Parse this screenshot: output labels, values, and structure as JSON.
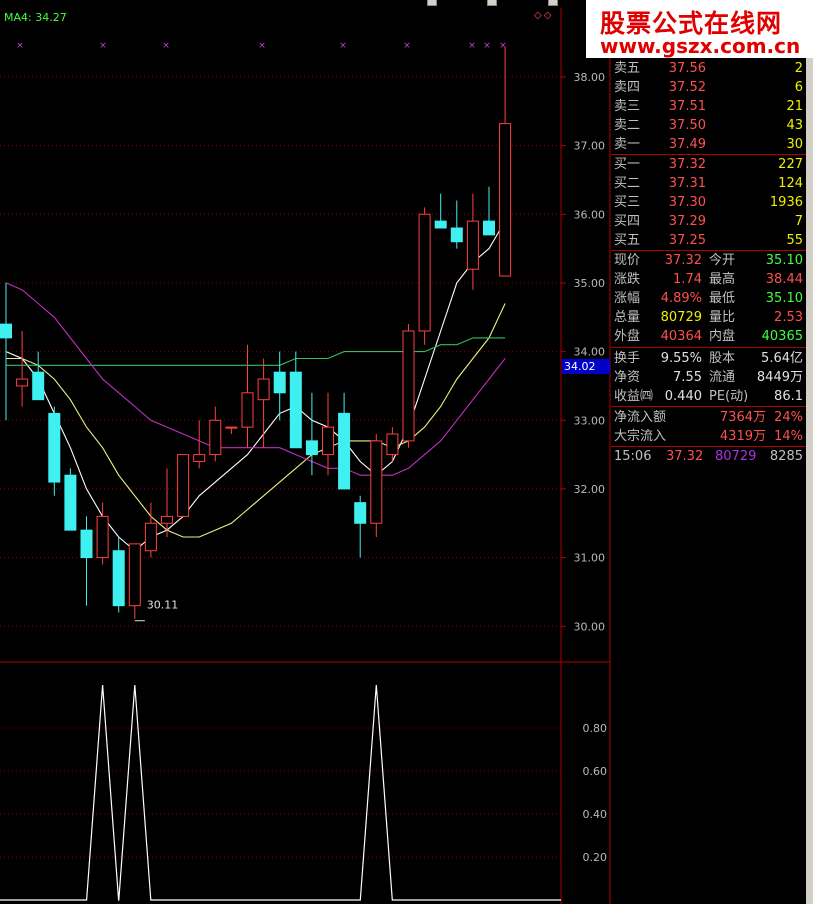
{
  "window": {
    "title": "",
    "buttons": [
      "",
      "",
      ""
    ]
  },
  "indicator": {
    "ma_label": "MA4: 34.27",
    "corner_mark": "◇◇"
  },
  "chart": {
    "price_axis": [
      "38.00",
      "37.00",
      "36.00",
      "35.00",
      "34.00",
      "33.00",
      "32.00",
      "31.00",
      "30.00"
    ],
    "current_price_tag": "34.02",
    "low_annotation": "30.11",
    "lower_axis": [
      "0.80",
      "0.60",
      "0.40",
      "0.20"
    ]
  },
  "chart_data": {
    "type": "candlestick",
    "ylim": [
      29.8,
      38.8
    ],
    "candles": [
      {
        "o": 34.2,
        "h": 35.0,
        "l": 33.0,
        "c": 34.4,
        "up": false
      },
      {
        "o": 33.6,
        "h": 34.3,
        "l": 33.2,
        "c": 33.5,
        "up": true
      },
      {
        "o": 33.7,
        "h": 34.0,
        "l": 33.3,
        "c": 33.3,
        "up": false
      },
      {
        "o": 33.1,
        "h": 33.2,
        "l": 31.9,
        "c": 32.1,
        "up": false
      },
      {
        "o": 32.2,
        "h": 32.3,
        "l": 31.4,
        "c": 31.4,
        "up": false
      },
      {
        "o": 31.4,
        "h": 31.6,
        "l": 30.3,
        "c": 31.0,
        "up": false
      },
      {
        "o": 31.0,
        "h": 31.8,
        "l": 30.9,
        "c": 31.6,
        "up": true
      },
      {
        "o": 31.1,
        "h": 31.3,
        "l": 30.2,
        "c": 30.3,
        "up": false
      },
      {
        "o": 30.3,
        "h": 31.2,
        "l": 30.11,
        "c": 31.2,
        "up": true
      },
      {
        "o": 31.1,
        "h": 31.8,
        "l": 31.0,
        "c": 31.5,
        "up": true
      },
      {
        "o": 31.5,
        "h": 32.3,
        "l": 31.3,
        "c": 31.6,
        "up": true
      },
      {
        "o": 31.6,
        "h": 32.5,
        "l": 31.6,
        "c": 32.5,
        "up": true
      },
      {
        "o": 32.4,
        "h": 33.0,
        "l": 32.3,
        "c": 32.5,
        "up": true
      },
      {
        "o": 32.5,
        "h": 33.2,
        "l": 32.4,
        "c": 33.0,
        "up": true
      },
      {
        "o": 32.9,
        "h": 32.9,
        "l": 32.8,
        "c": 32.9,
        "up": true
      },
      {
        "o": 32.9,
        "h": 34.1,
        "l": 32.6,
        "c": 33.4,
        "up": true
      },
      {
        "o": 33.3,
        "h": 33.9,
        "l": 32.6,
        "c": 33.6,
        "up": true
      },
      {
        "o": 33.7,
        "h": 34.0,
        "l": 33.0,
        "c": 33.4,
        "up": false
      },
      {
        "o": 33.7,
        "h": 34.0,
        "l": 32.6,
        "c": 32.6,
        "up": false
      },
      {
        "o": 32.7,
        "h": 33.4,
        "l": 32.2,
        "c": 32.5,
        "up": false
      },
      {
        "o": 32.5,
        "h": 33.4,
        "l": 32.2,
        "c": 32.9,
        "up": true
      },
      {
        "o": 33.1,
        "h": 33.4,
        "l": 32.0,
        "c": 32.0,
        "up": false
      },
      {
        "o": 31.8,
        "h": 31.9,
        "l": 31.0,
        "c": 31.5,
        "up": false
      },
      {
        "o": 31.5,
        "h": 32.8,
        "l": 31.3,
        "c": 32.7,
        "up": true
      },
      {
        "o": 32.5,
        "h": 32.9,
        "l": 32.4,
        "c": 32.8,
        "up": true
      },
      {
        "o": 32.7,
        "h": 34.4,
        "l": 32.6,
        "c": 34.3,
        "up": true
      },
      {
        "o": 34.3,
        "h": 36.1,
        "l": 34.1,
        "c": 36.0,
        "up": true
      },
      {
        "o": 35.9,
        "h": 36.3,
        "l": 35.8,
        "c": 35.8,
        "up": false
      },
      {
        "o": 35.8,
        "h": 36.2,
        "l": 35.5,
        "c": 35.6,
        "up": false
      },
      {
        "o": 35.2,
        "h": 36.3,
        "l": 34.9,
        "c": 35.9,
        "up": true
      },
      {
        "o": 35.9,
        "h": 36.4,
        "l": 35.7,
        "c": 35.7,
        "up": false
      },
      {
        "o": 35.1,
        "h": 38.44,
        "l": 35.1,
        "c": 37.32,
        "up": true
      }
    ],
    "ma_series": [
      {
        "name": "MA4",
        "color": "#ffffff",
        "values": [
          34.0,
          33.9,
          33.6,
          33.1,
          32.6,
          32.0,
          31.6,
          31.3,
          31.1,
          31.3,
          31.4,
          31.6,
          31.9,
          32.1,
          32.3,
          32.5,
          32.8,
          33.1,
          33.2,
          33.0,
          32.9,
          32.7,
          32.4,
          32.2,
          32.4,
          32.9,
          33.6,
          34.3,
          35.0,
          35.3,
          35.5,
          35.9
        ]
      },
      {
        "name": "MA10",
        "color": "#f0f080",
        "values": [
          33.9,
          33.9,
          33.8,
          33.6,
          33.3,
          32.9,
          32.6,
          32.2,
          31.9,
          31.6,
          31.4,
          31.3,
          31.3,
          31.4,
          31.5,
          31.7,
          31.9,
          32.1,
          32.3,
          32.5,
          32.6,
          32.7,
          32.7,
          32.7,
          32.6,
          32.7,
          32.9,
          33.2,
          33.6,
          33.9,
          34.2,
          34.7
        ]
      },
      {
        "name": "MA60",
        "color": "#30c060",
        "values": [
          33.8,
          33.8,
          33.8,
          33.8,
          33.8,
          33.8,
          33.8,
          33.8,
          33.8,
          33.8,
          33.8,
          33.8,
          33.8,
          33.8,
          33.8,
          33.8,
          33.8,
          33.8,
          33.9,
          33.9,
          33.9,
          34.0,
          34.0,
          34.0,
          34.0,
          34.0,
          34.0,
          34.1,
          34.1,
          34.2,
          34.2,
          34.2
        ]
      },
      {
        "name": "MA20",
        "color": "#c030c0",
        "values": [
          35.0,
          34.9,
          34.7,
          34.5,
          34.2,
          33.9,
          33.6,
          33.4,
          33.2,
          33.0,
          32.9,
          32.8,
          32.7,
          32.6,
          32.6,
          32.6,
          32.6,
          32.6,
          32.5,
          32.4,
          32.3,
          32.3,
          32.2,
          32.2,
          32.2,
          32.3,
          32.5,
          32.7,
          33.0,
          33.3,
          33.6,
          33.9
        ]
      }
    ],
    "signal": {
      "ylim": [
        0,
        1
      ],
      "values": [
        0,
        0,
        0,
        0,
        0,
        0,
        1,
        0,
        1,
        0,
        0,
        0,
        0,
        0,
        0,
        0,
        0,
        0,
        0,
        0,
        0,
        0,
        0,
        1,
        0,
        0,
        0,
        0,
        0,
        0,
        0,
        0
      ]
    }
  },
  "quote": {
    "asks": [
      {
        "label": "卖五",
        "price": "37.56",
        "vol": "2"
      },
      {
        "label": "卖四",
        "price": "37.52",
        "vol": "6"
      },
      {
        "label": "卖三",
        "price": "37.51",
        "vol": "21"
      },
      {
        "label": "卖二",
        "price": "37.50",
        "vol": "43"
      },
      {
        "label": "卖一",
        "price": "37.49",
        "vol": "30"
      }
    ],
    "bids": [
      {
        "label": "买一",
        "price": "37.32",
        "vol": "227"
      },
      {
        "label": "买二",
        "price": "37.31",
        "vol": "124"
      },
      {
        "label": "买三",
        "price": "37.30",
        "vol": "1936"
      },
      {
        "label": "买四",
        "price": "37.29",
        "vol": "7"
      },
      {
        "label": "买五",
        "price": "37.25",
        "vol": "55"
      }
    ],
    "stats": [
      {
        "k1": "现价",
        "v1": "37.32",
        "c1": "red",
        "k2": "今开",
        "v2": "35.10",
        "c2": "green"
      },
      {
        "k1": "涨跌",
        "v1": "1.74",
        "c1": "red",
        "k2": "最高",
        "v2": "38.44",
        "c2": "red"
      },
      {
        "k1": "涨幅",
        "v1": "4.89%",
        "c1": "red",
        "k2": "最低",
        "v2": "35.10",
        "c2": "green"
      },
      {
        "k1": "总量",
        "v1": "80729",
        "c1": "yellow",
        "k2": "量比",
        "v2": "2.53",
        "c2": "red"
      },
      {
        "k1": "外盘",
        "v1": "40364",
        "c1": "red",
        "k2": "内盘",
        "v2": "40365",
        "c2": "green"
      }
    ],
    "stats2": [
      {
        "k1": "换手",
        "v1": "9.55%",
        "c1": "white",
        "k2": "股本",
        "v2": "5.64亿",
        "c2": "white"
      },
      {
        "k1": "净资",
        "v1": "7.55",
        "c1": "white",
        "k2": "流通",
        "v2": "8449万",
        "c2": "white"
      },
      {
        "k1": "收益㈣",
        "v1": "0.440",
        "c1": "white",
        "k2": "PE(动)",
        "v2": "86.1",
        "c2": "white"
      }
    ],
    "flows": [
      {
        "k1": "净流入额",
        "v1": "7364万",
        "c1": "red",
        "v2": "24%",
        "c2": "red"
      },
      {
        "k1": "大宗流入",
        "v1": "4319万",
        "c1": "red",
        "v2": "14%",
        "c2": "red"
      }
    ],
    "tick": {
      "time": "15:06",
      "price": "37.32",
      "vol": "80729",
      "num": "8285"
    }
  },
  "watermark": {
    "line1": "股票公式在线网",
    "line2": "www.gszx.com.cn"
  }
}
